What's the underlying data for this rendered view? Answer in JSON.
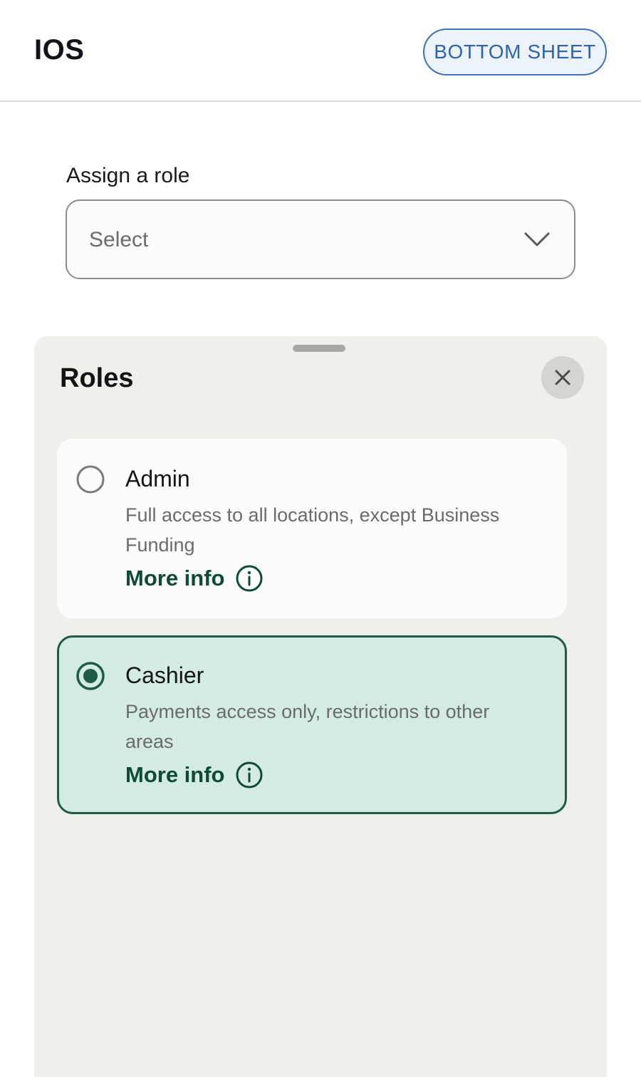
{
  "header": {
    "title": "IOS",
    "button_label": "BOTTOM SHEET"
  },
  "form": {
    "label": "Assign a role",
    "select_placeholder": "Select"
  },
  "sheet": {
    "title": "Roles",
    "roles": [
      {
        "name": "Admin",
        "description": "Full access to all locations, except Business Funding",
        "more_info": "More info",
        "selected": false
      },
      {
        "name": "Cashier",
        "description": "Payments access only, restrictions to other areas",
        "more_info": "More info",
        "selected": true
      }
    ]
  },
  "colors": {
    "accent_green": "#1e5c48",
    "selected_bg": "#d4ebe4",
    "link_blue": "#2f63ad",
    "sheet_bg": "#efefeb"
  },
  "icons": [
    "chevron-down-icon",
    "close-icon",
    "info-icon",
    "radio-unchecked-icon",
    "radio-checked-icon"
  ]
}
